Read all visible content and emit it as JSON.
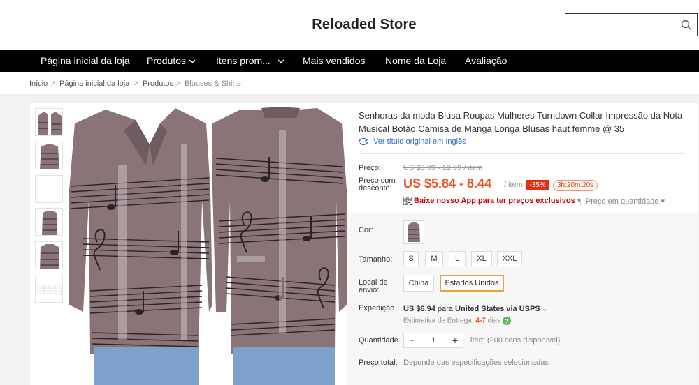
{
  "header": {
    "store_name": "Reloaded Store",
    "search_placeholder": ""
  },
  "nav": {
    "items": [
      {
        "label": "Página inicial da loja"
      },
      {
        "label": "Produtos"
      },
      {
        "label": "Ítens prom..."
      },
      {
        "label": "Mais vendidos"
      },
      {
        "label": "Nome da Loja"
      },
      {
        "label": "Avaliação"
      }
    ]
  },
  "breadcrumb": {
    "items": [
      "Início",
      "Página inicial da loja",
      "Produtos",
      "Blouses & Shirts"
    ],
    "separator": ">"
  },
  "product": {
    "title": "Senhoras da moda Blusa Roupas Mulheres Turndown Collar Impressão da Nota Musical Botão Camisa de Manga Longa Blusas haut femme @ 35",
    "translate_link": "Ver título original em Inglês",
    "price_label": "Preço:",
    "original_price": "US $8.99 - 12.99 / item",
    "discount_label": "Preço com desconto:",
    "discount_price": "US $5.84 - 8.44",
    "per_item": "/ item",
    "discount_badge": "-35%",
    "countdown": "3h:20m:20s",
    "app_promo": "Baixe nosso App para ter preços exclusivos",
    "bulk_price": "Preço em quantidade",
    "color_label": "Cor:",
    "size_label": "Tamanho:",
    "sizes": [
      "S",
      "M",
      "L",
      "XL",
      "XXL"
    ],
    "ship_from_label": "Local de envio:",
    "ship_from_options": [
      "China",
      "Estados Unidos"
    ],
    "ship_from_selected": "Estados Unidos",
    "shipping_label": "Expedição",
    "shipping_cost": "US $6.94",
    "shipping_for": "para",
    "shipping_dest": "United States via USPS",
    "delivery_estimate_label": "Estimativa de Entrega:",
    "delivery_days": "4-7",
    "delivery_unit": "dias",
    "quantity_label": "Quantidade",
    "quantity_value": "1",
    "quantity_available": "item (200 itens disponível)",
    "total_label": "Preço total:",
    "total_note": "Depende das especificações selecionadas"
  },
  "colors": {
    "accent_orange": "#f0541e",
    "badge_red": "#e52d12",
    "link_blue": "#2d6ec2",
    "selected_border": "#e8a23a",
    "shirt": "#8a7478"
  },
  "icons": {
    "search": "search-icon",
    "chevron": "chevron-down-icon",
    "translate": "translate-icon",
    "qr": "qr-code-icon",
    "help": "help-icon"
  }
}
